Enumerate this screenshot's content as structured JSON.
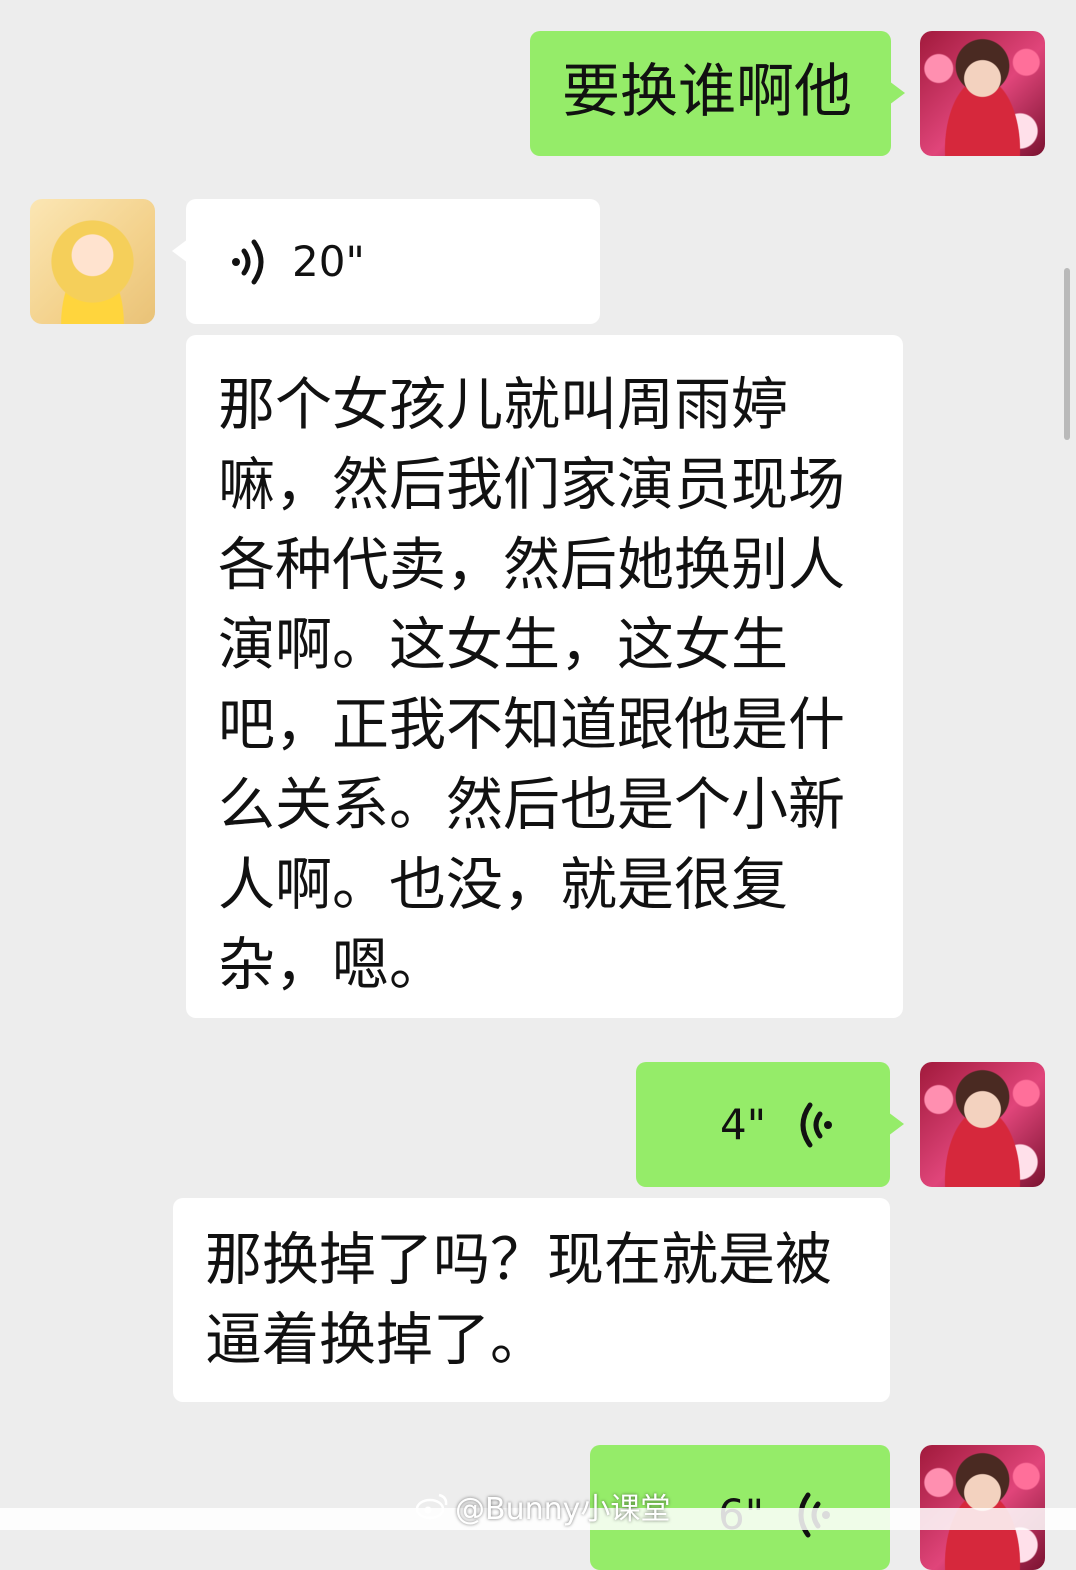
{
  "messages": [
    {
      "sender": "self",
      "type": "text",
      "text": "要换谁啊他"
    },
    {
      "sender": "other",
      "type": "voice",
      "duration": "20\""
    },
    {
      "sender": "other",
      "type": "transcript",
      "lines": [
        "那个女孩儿就叫周雨婷",
        "嘛，然后我们家演员现场",
        "各种代卖，然后她换别人",
        "演啊。这女生，这女生",
        "吧，正我不知道跟他是什",
        "么关系。然后也是个小新",
        "人啊。也没，就是很复",
        "杂，嗯。"
      ]
    },
    {
      "sender": "self",
      "type": "voice",
      "duration": "4\""
    },
    {
      "sender": "other",
      "type": "transcript",
      "lines": [
        "那换掉了吗？现在就是被",
        "逼着换掉了。"
      ]
    },
    {
      "sender": "self",
      "type": "voice",
      "duration": "6\""
    }
  ],
  "watermark": "@Bunny小课堂",
  "colors": {
    "background": "#ededed",
    "self_bubble": "#95ec69",
    "other_bubble": "#ffffff"
  },
  "icons": {
    "voice": "voice-wave-icon",
    "watermark": "weibo-icon"
  }
}
